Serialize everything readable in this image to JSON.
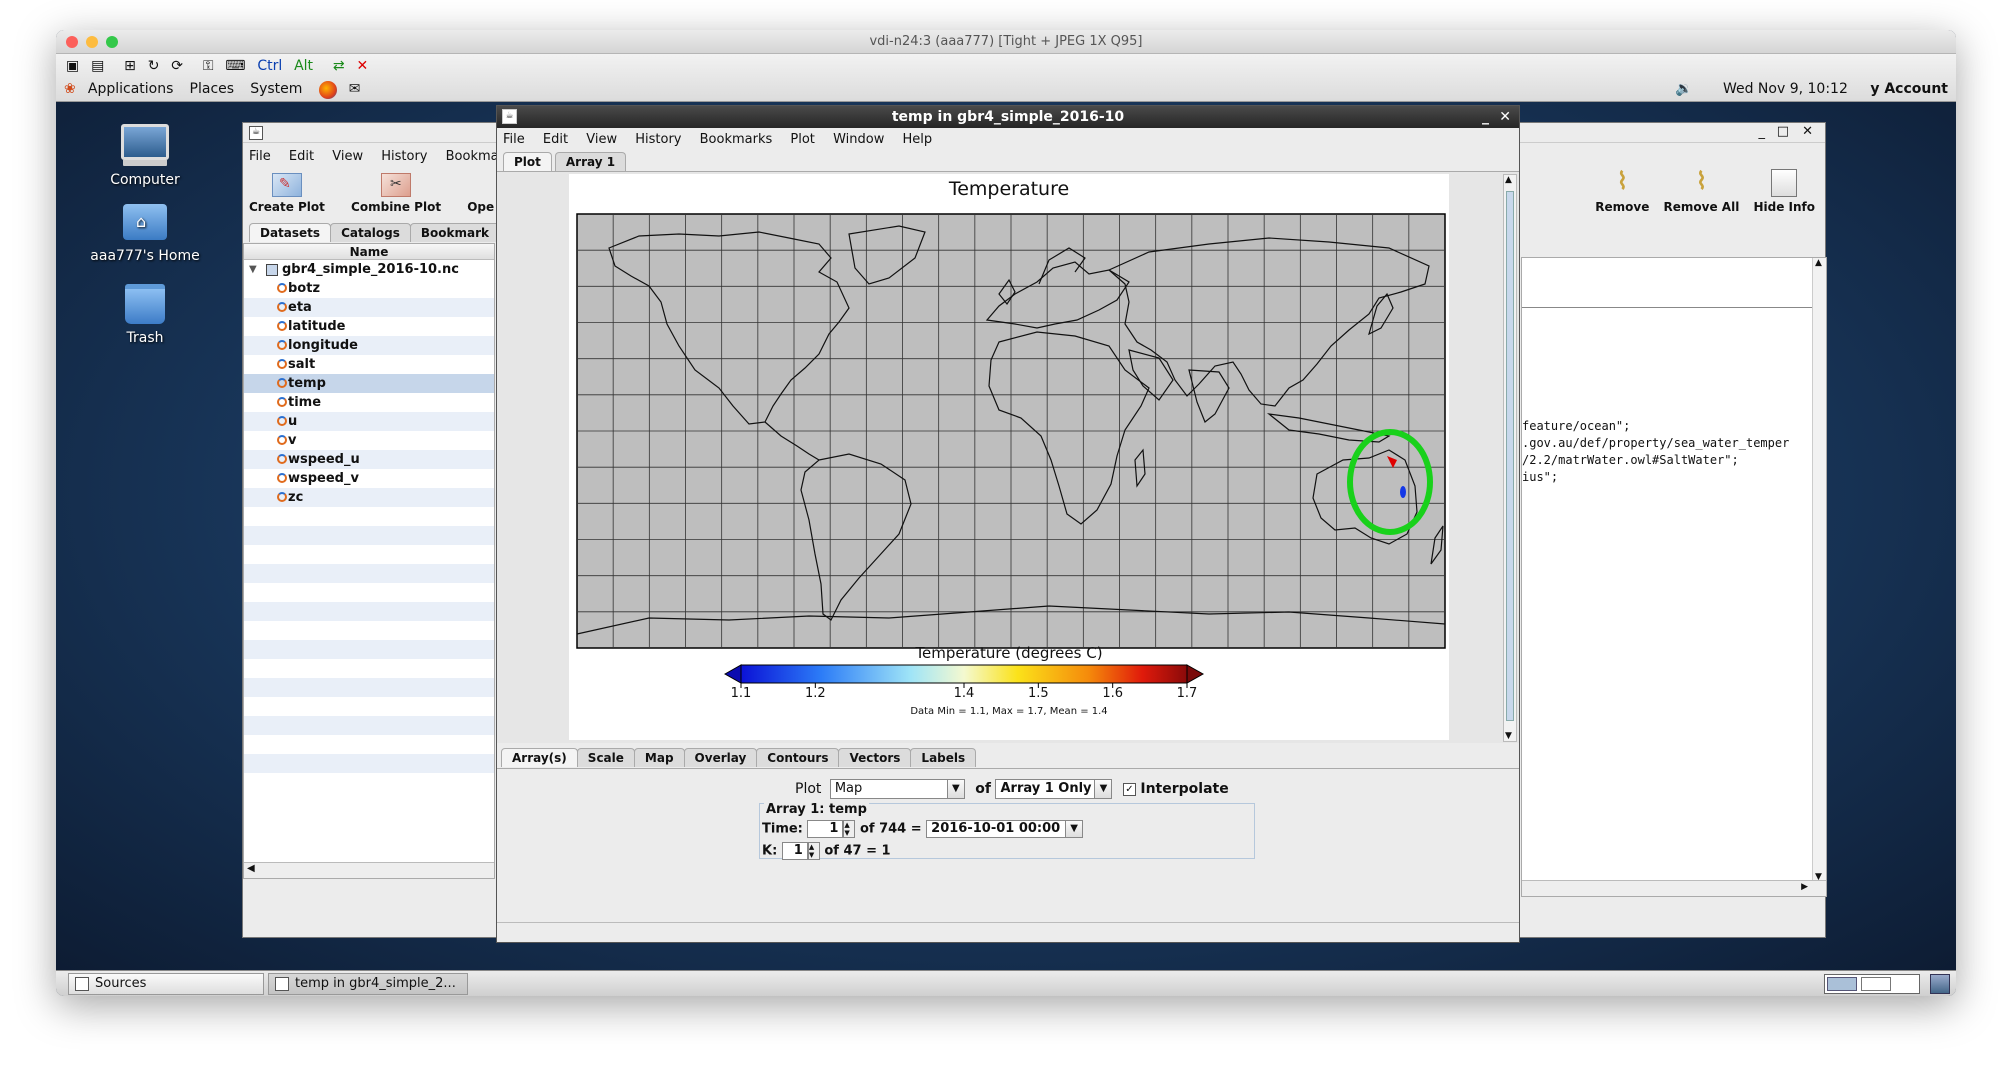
{
  "vnc": {
    "title": "vdi-n24:3 (aaa777) [Tight + JPEG 1X Q95]"
  },
  "topbar": {
    "toolbar_glyphs": [
      "Ctrl",
      "Alt"
    ],
    "menus": [
      "Applications",
      "Places",
      "System"
    ],
    "clock": "Wed Nov  9, 10:12",
    "account": "y Account"
  },
  "desktop": {
    "icons": [
      {
        "label": "Computer"
      },
      {
        "label": "aaa777's Home"
      },
      {
        "label": "Trash"
      }
    ]
  },
  "taskbar": {
    "items": [
      "Sources",
      "temp in gbr4_simple_2..."
    ]
  },
  "panoply": {
    "menu": [
      "File",
      "Edit",
      "View",
      "History",
      "Bookma"
    ],
    "tools": [
      "Create Plot",
      "Combine Plot",
      "Ope"
    ],
    "tabs": [
      "Datasets",
      "Catalogs",
      "Bookmark"
    ],
    "column_header": "Name",
    "dataset": "gbr4_simple_2016-10.nc",
    "variables": [
      "botz",
      "eta",
      "latitude",
      "longitude",
      "salt",
      "temp",
      "time",
      "u",
      "v",
      "wspeed_u",
      "wspeed_v",
      "zc"
    ],
    "selected": "temp"
  },
  "sources": {
    "tools": [
      "Remove",
      "Remove All",
      "Hide Info"
    ],
    "info_lines": [
      "feature/ocean\";",
      ".gov.au/def/property/sea_water_temper",
      "/2.2/matrWater.owl#SaltWater\";",
      "ius\";"
    ]
  },
  "plotwin": {
    "title": "temp in gbr4_simple_2016-10",
    "menu": [
      "File",
      "Edit",
      "View",
      "History",
      "Bookmarks",
      "Plot",
      "Window",
      "Help"
    ],
    "tabs": [
      "Plot",
      "Array 1"
    ],
    "plot_title": "Temperature",
    "colorbar": {
      "label": "Temperature (degrees C)",
      "ticks": [
        "1.1",
        "1.2",
        "1.4",
        "1.5",
        "1.6",
        "1.7"
      ],
      "stats": "Data Min = 1.1, Max = 1.7, Mean = 1.4"
    },
    "bottom_tabs": [
      "Array(s)",
      "Scale",
      "Map",
      "Overlay",
      "Contours",
      "Vectors",
      "Labels"
    ],
    "controls": {
      "plot_label": "Plot",
      "plot_value": "Map",
      "of_label": "of",
      "arrays_value": "Array 1 Only",
      "interpolate_label": "Interpolate",
      "array_group": "Array 1: temp",
      "time_label": "Time:",
      "time_index": "1",
      "time_of": "of 744 =",
      "time_value": "2016-10-01 00:00",
      "k_label": "K:",
      "k_index": "1",
      "k_of": "of 47 = 1"
    },
    "colors": {
      "annotation_circle": "#19d11b",
      "map_ocean": "#bebebe"
    }
  }
}
